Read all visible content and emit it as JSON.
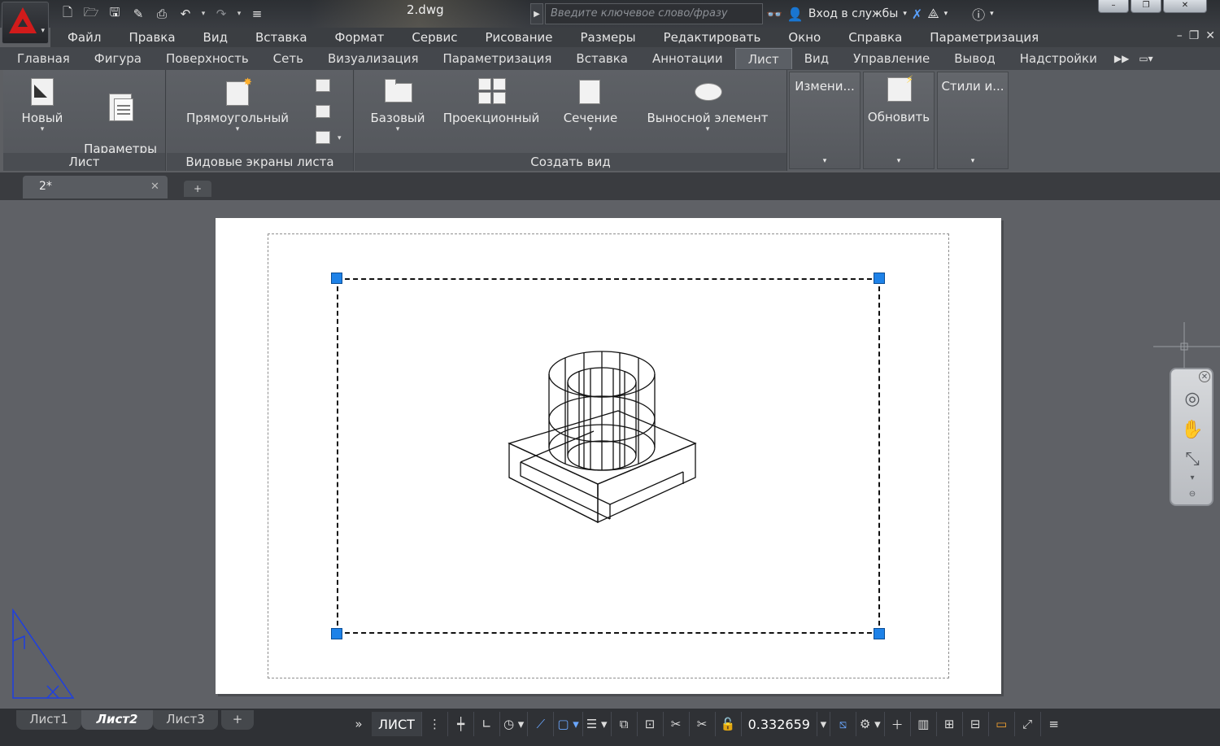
{
  "window": {
    "title": "2.dwg",
    "search_placeholder": "Введите ключевое слово/фразу",
    "signin_label": "Вход в службы",
    "signin_dd": "▾",
    "controls": [
      "–",
      "❐",
      "✕"
    ]
  },
  "qat": {
    "icons": [
      "new-icon",
      "open-icon",
      "save-icon",
      "saveas-icon",
      "plot-icon",
      "undo-icon",
      "redo-icon",
      "customize-icon"
    ]
  },
  "menu": {
    "items": [
      "Файл",
      "Правка",
      "Вид",
      "Вставка",
      "Формат",
      "Сервис",
      "Рисование",
      "Размеры",
      "Редактировать",
      "Окно",
      "Справка",
      "Параметризация"
    ],
    "doc_controls": [
      "–",
      "❐",
      "✕"
    ]
  },
  "ribbon_tabs": {
    "items": [
      "Главная",
      "Фигура",
      "Поверхность",
      "Сеть",
      "Визуализация",
      "Параметризация",
      "Вставка",
      "Аннотации",
      "Лист",
      "Вид",
      "Управление",
      "Вывод",
      "Надстройки"
    ],
    "active": "Лист",
    "overflow": "▶▶"
  },
  "ribbon": {
    "panels": {
      "sheet": {
        "title": "Лист",
        "new_label": "Новый",
        "page_setup_label": "Параметры\nстраницы"
      },
      "viewports": {
        "title": "Видовые экраны листа",
        "rect_label": "Прямоугольный"
      },
      "create_view": {
        "title": "Создать вид",
        "base_label": "Базовый",
        "projected_label": "Проекционный",
        "section_label": "Сечение",
        "detail_label": "Выносной элемент"
      },
      "modify": {
        "title": "Измени..."
      },
      "update": {
        "title": "Обновить"
      },
      "styles": {
        "title": "Стили и..."
      }
    }
  },
  "doc_tabs": {
    "active": "2*",
    "close": "✕",
    "add": "+"
  },
  "layout_tabs": {
    "items": [
      "Лист1",
      "Лист2",
      "Лист3"
    ],
    "active": "Лист2",
    "add": "+"
  },
  "status": {
    "space_label": "ЛИСТ",
    "scale_value": "0.332659",
    "more": "»"
  }
}
